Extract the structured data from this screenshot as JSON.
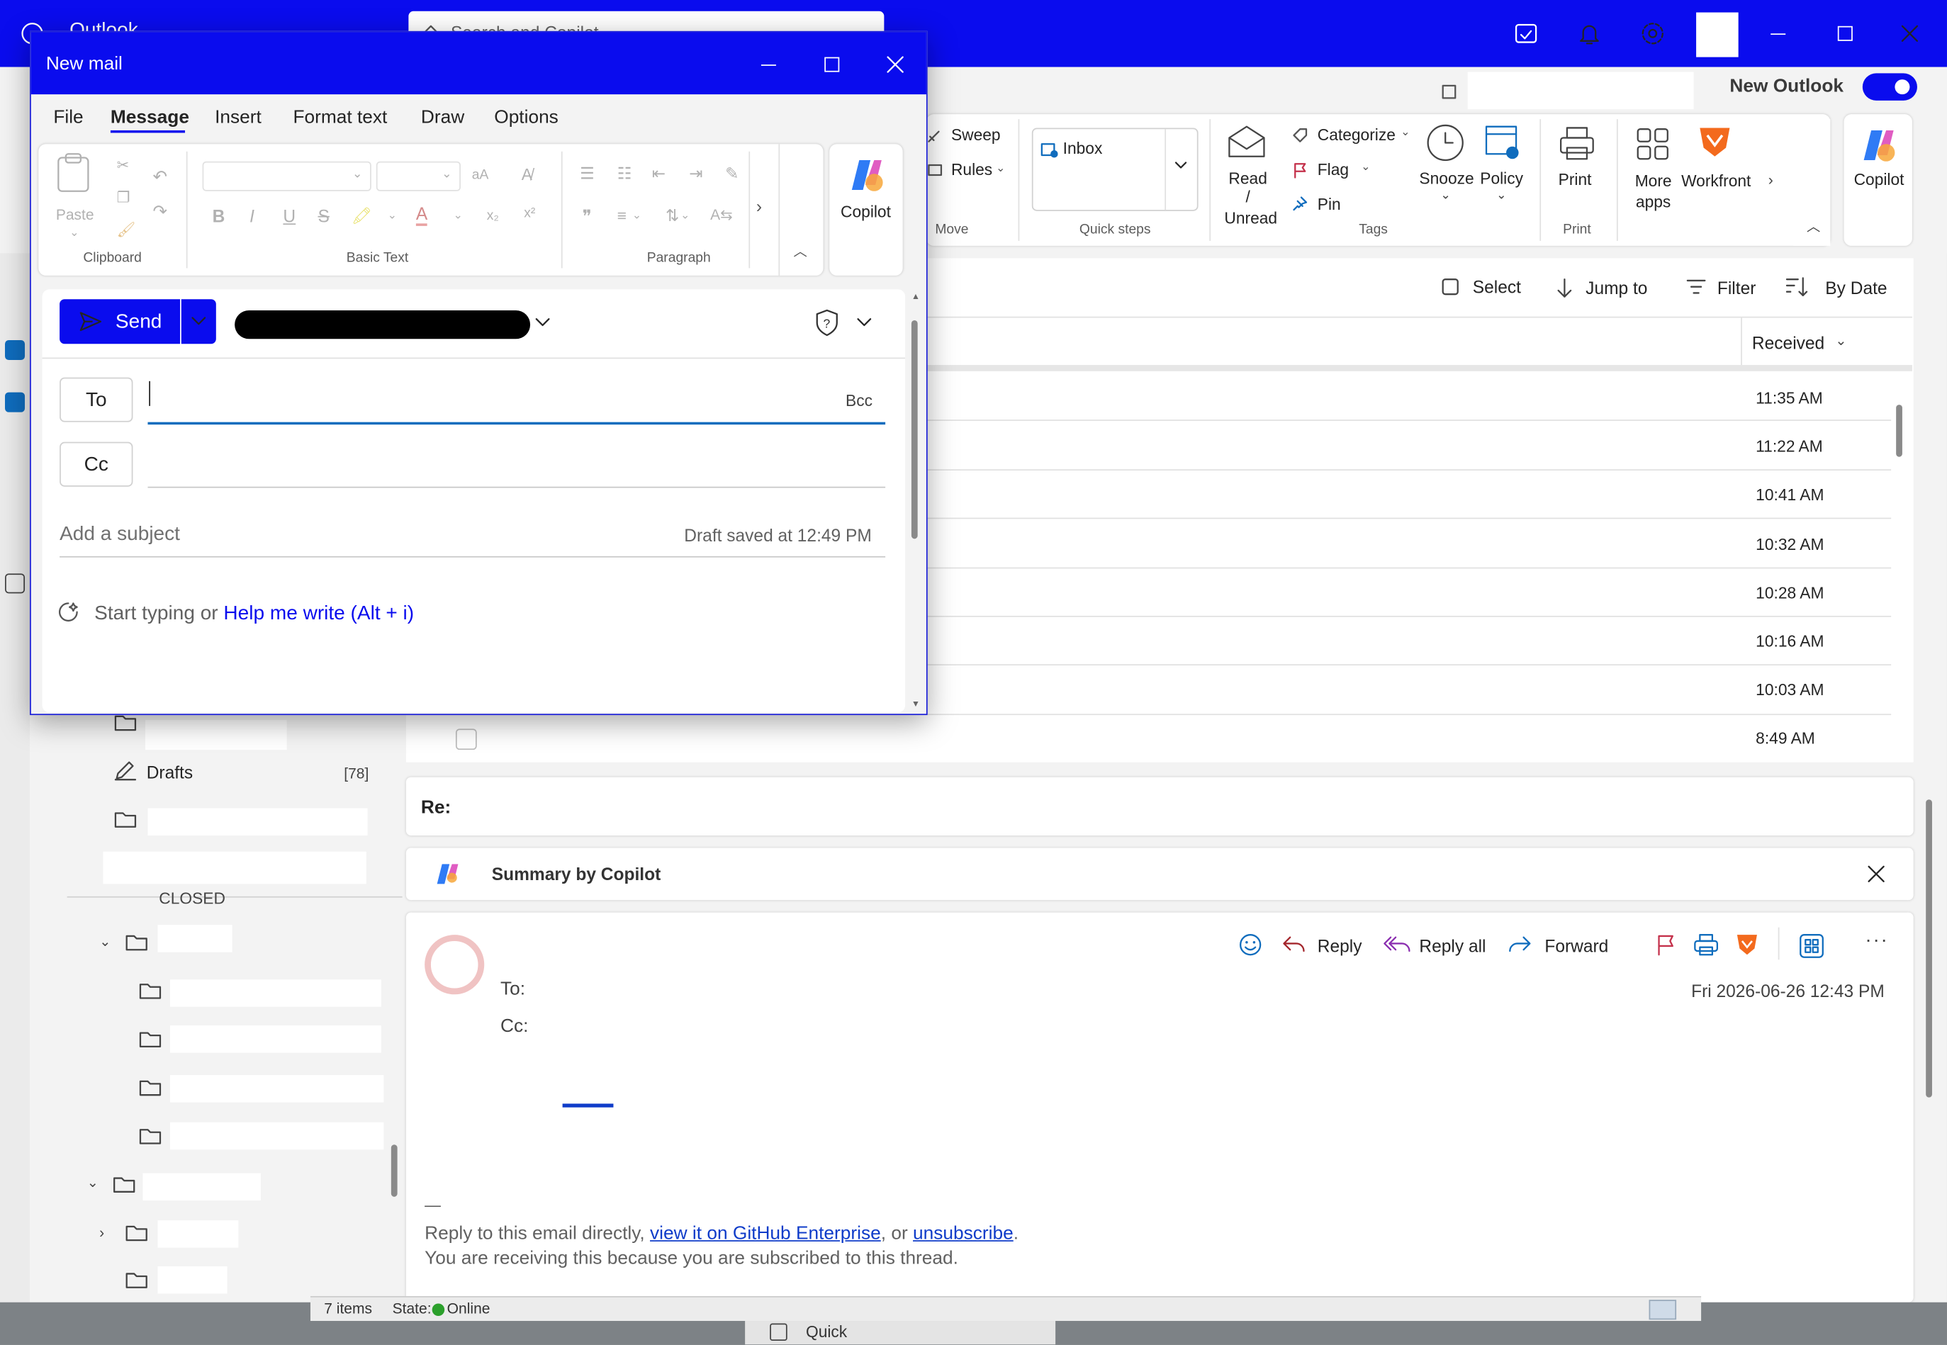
{
  "app": {
    "title_partial": "Outlook",
    "search_placeholder_partial": "Search and Copilot",
    "new_outlook_label": "New Outlook",
    "new_outlook_toggle": true,
    "accent": "#0a0cee"
  },
  "ribbon": {
    "sweep": "Sweep",
    "rules": "Rules",
    "move_group": "Move",
    "inbox": "Inbox",
    "quick_steps": "Quick steps",
    "read_unread_1": "Read /",
    "read_unread_2": "Unread",
    "categorize": "Categorize",
    "flag": "Flag",
    "pin": "Pin",
    "snooze": "Snooze",
    "policy": "Policy",
    "tags_group": "Tags",
    "print": "Print",
    "print_group": "Print",
    "more_apps_1": "More",
    "more_apps_2": "apps",
    "workfront": "Workfront",
    "copilot": "Copilot"
  },
  "list_toolbar": {
    "select": "Select",
    "jump_to": "Jump to",
    "filter": "Filter",
    "sort": "By Date",
    "column_received": "Received"
  },
  "messages": [
    {
      "time": "11:35 AM"
    },
    {
      "time": "11:22 AM"
    },
    {
      "time": "10:41 AM"
    },
    {
      "time": "10:32 AM"
    },
    {
      "time": "10:28 AM"
    },
    {
      "time": "10:16 AM"
    },
    {
      "time": "10:03 AM"
    },
    {
      "time": "8:49 AM"
    }
  ],
  "folders": {
    "drafts": "Drafts",
    "drafts_count": "[78]",
    "closed_partial": "CLOSED"
  },
  "reading": {
    "subject": "Re:",
    "summary": "Summary by Copilot",
    "reply": "Reply",
    "reply_all": "Reply all",
    "forward": "Forward",
    "to_label": "To:",
    "cc_label": "Cc:",
    "date": "Fri 2026-06-26 12:43 PM",
    "dash": "—",
    "footer1_pre": "Reply to this email directly, ",
    "footer1_link1": "view it on GitHub Enterprise",
    "footer1_mid": ", or ",
    "footer1_link2": "unsubscribe",
    "footer1_post": ".",
    "footer2": "You are receiving this because you are subscribed to this thread."
  },
  "status": {
    "items": "7 items",
    "state": "State:",
    "online": "Online",
    "quick_partial": "Quick"
  },
  "compose": {
    "title": "New mail",
    "tabs": [
      "File",
      "Message",
      "Insert",
      "Format text",
      "Draw",
      "Options"
    ],
    "active_tab": "Message",
    "paste": "Paste",
    "clipboard": "Clipboard",
    "basic_text": "Basic Text",
    "paragraph": "Paragraph",
    "copilot": "Copilot",
    "send": "Send",
    "to": "To",
    "cc": "Cc",
    "bcc": "Bcc",
    "subject_placeholder": "Add a subject",
    "draft_saved": "Draft saved at 12:49 PM",
    "start_typing": "Start typing or ",
    "help_me_write": "Help me write (Alt + i)"
  }
}
